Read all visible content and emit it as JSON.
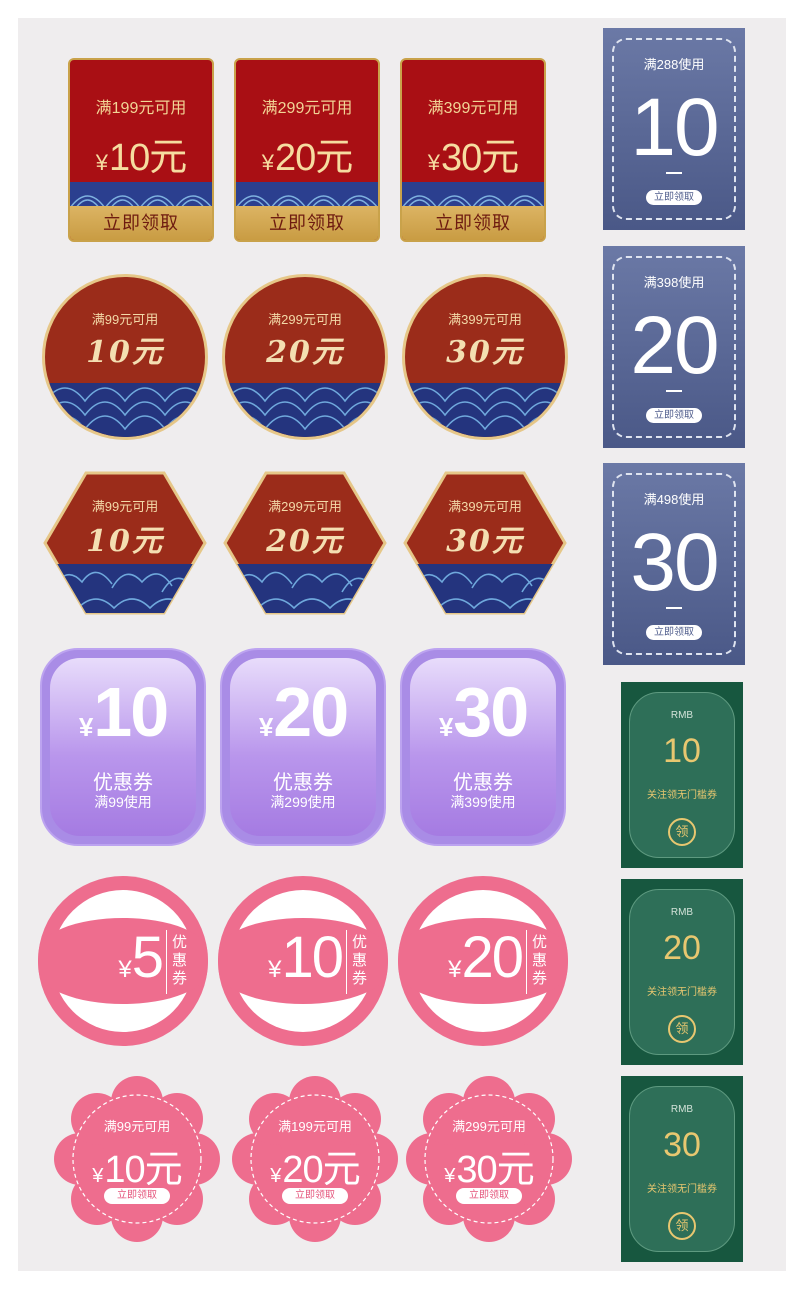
{
  "colors": {
    "red": "#a90f14",
    "gold": "#c9a24a",
    "rust": "#9b2c1a",
    "wave_blue": "#2b3f8f",
    "purple": "#a98ce6",
    "pink": "#ee6d8e",
    "slate_blue": "#5a6796",
    "dark_green": "#17573f"
  },
  "red_rect_coupons": [
    {
      "condition": "满199元可用",
      "currency": "¥",
      "amount": "10元",
      "claim": "立即领取"
    },
    {
      "condition": "满299元可用",
      "currency": "¥",
      "amount": "20元",
      "claim": "立即领取"
    },
    {
      "condition": "满399元可用",
      "currency": "¥",
      "amount": "30元",
      "claim": "立即领取"
    }
  ],
  "red_circle_coupons": [
    {
      "condition": "满99元可用",
      "amount": "10元"
    },
    {
      "condition": "满299元可用",
      "amount": "20元"
    },
    {
      "condition": "满399元可用",
      "amount": "30元"
    }
  ],
  "hexagon_coupons": [
    {
      "condition": "满99元可用",
      "amount": "10元"
    },
    {
      "condition": "满299元可用",
      "amount": "20元"
    },
    {
      "condition": "满399元可用",
      "amount": "30元"
    }
  ],
  "purple_coupons": [
    {
      "currency": "¥",
      "amount": "10",
      "label": "优惠券",
      "condition": "满99使用"
    },
    {
      "currency": "¥",
      "amount": "20",
      "label": "优惠券",
      "condition": "满299使用"
    },
    {
      "currency": "¥",
      "amount": "30",
      "label": "优惠券",
      "condition": "满399使用"
    }
  ],
  "pink_circle_coupons": [
    {
      "currency": "¥",
      "amount": "5",
      "label": "优惠券"
    },
    {
      "currency": "¥",
      "amount": "10",
      "label": "优惠券"
    },
    {
      "currency": "¥",
      "amount": "20",
      "label": "优惠券"
    }
  ],
  "scallop_coupons": [
    {
      "condition": "满99元可用",
      "currency": "¥",
      "amount": "10元",
      "claim": "立即领取"
    },
    {
      "condition": "满199元可用",
      "currency": "¥",
      "amount": "20元",
      "claim": "立即领取"
    },
    {
      "condition": "满299元可用",
      "currency": "¥",
      "amount": "30元",
      "claim": "立即领取"
    }
  ],
  "blue_tickets": [
    {
      "condition": "满288使用",
      "amount": "10",
      "claim": "立即领取"
    },
    {
      "condition": "满398使用",
      "amount": "20",
      "claim": "立即领取"
    },
    {
      "condition": "满498使用",
      "amount": "30",
      "claim": "立即领取"
    }
  ],
  "green_tickets": [
    {
      "unit": "RMB",
      "amount": "10",
      "label": "关注领无门槛券",
      "claim": "领"
    },
    {
      "unit": "RMB",
      "amount": "20",
      "label": "关注领无门槛券",
      "claim": "领"
    },
    {
      "unit": "RMB",
      "amount": "30",
      "label": "关注领无门槛券",
      "claim": "领"
    }
  ]
}
